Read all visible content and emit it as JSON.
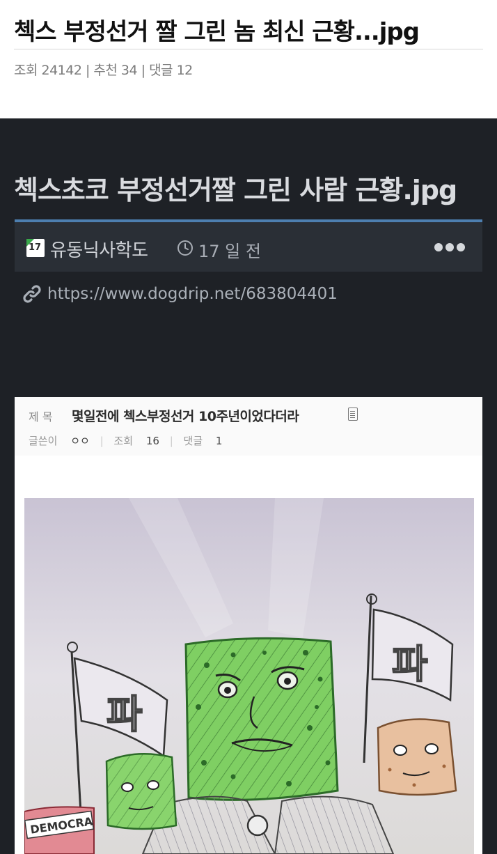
{
  "post": {
    "title": "첵스 부정선거 짤 그린 놈 최신 근황...jpg",
    "meta": "조회 24142 | 추천 34 | 댓글 12"
  },
  "article": {
    "title": "첵스초코 부정선거짤 그린 사람 근황.jpg",
    "board_icon_text": "17",
    "board": "유동닉사학도",
    "time_ago": "17 일 전",
    "source_url": "https://www.dogdrip.net/683804401"
  },
  "embedded_post": {
    "subject_label": "제 목",
    "subject": "몇일전에 첵스부정선거 10주년이었다더라",
    "author_label": "글쓴이",
    "author": "ㅇㅇ",
    "views_label": "조회",
    "views": "16",
    "comments_label": "댓글",
    "comments": "1"
  },
  "drawing": {
    "flag_text_left": "파",
    "flag_text_right": "파",
    "sign_text": "DEMOCRA"
  },
  "colors": {
    "dark_bg": "#1e2126",
    "info_bar": "#2a2f36",
    "accent": "#4d7fb0",
    "green_ink": "#3fa535"
  },
  "icons": [
    "board-icon",
    "clock-icon",
    "more-icon",
    "link-icon",
    "document-icon"
  ]
}
